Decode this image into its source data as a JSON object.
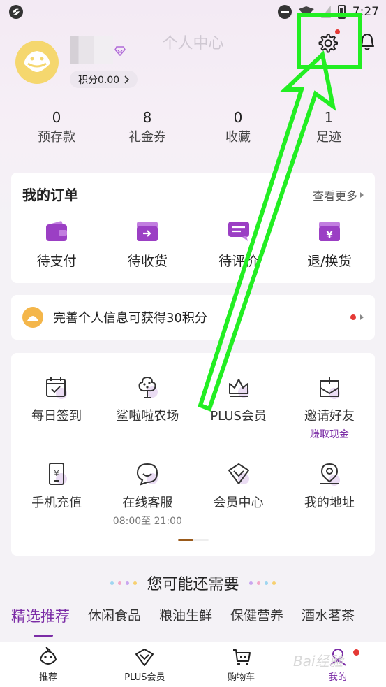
{
  "status_bar": {
    "time": "7:27"
  },
  "header": {
    "title": "个人中心",
    "points_label": "积分0.00"
  },
  "stats": [
    {
      "value": "0",
      "label": "预存款"
    },
    {
      "value": "8",
      "label": "礼金券"
    },
    {
      "value": "0",
      "label": "收藏"
    },
    {
      "value": "1",
      "label": "足迹"
    }
  ],
  "orders": {
    "title": "我的订单",
    "more": "查看更多",
    "items": [
      {
        "label": "待支付",
        "icon": "wallet-icon",
        "color": "#9b3fc4"
      },
      {
        "label": "待收货",
        "icon": "box-arrow-icon",
        "color": "#9b3fc4"
      },
      {
        "label": "待评价",
        "icon": "comment-icon",
        "color": "#9b3fc4"
      },
      {
        "label": "退/换货",
        "icon": "yen-box-icon",
        "color": "#9b3fc4"
      }
    ]
  },
  "info_banner": {
    "text": "完善个人信息可获得30积分"
  },
  "services": {
    "row1": [
      {
        "label": "每日签到",
        "sub": "",
        "icon": "calendar-check-icon"
      },
      {
        "label": "鲨啦啦农场",
        "sub": "",
        "icon": "tree-icon"
      },
      {
        "label": "PLUS会员",
        "sub": "",
        "icon": "crown-icon"
      },
      {
        "label": "邀请好友",
        "sub": "赚取现金",
        "icon": "invite-envelope-icon"
      }
    ],
    "row2": [
      {
        "label": "手机充值",
        "sub": "",
        "icon": "phone-yen-icon"
      },
      {
        "label": "在线客服",
        "sub": "08:00至 21:00",
        "icon": "chat-bubble-icon"
      },
      {
        "label": "会员中心",
        "sub": "",
        "icon": "diamond-icon"
      },
      {
        "label": "我的地址",
        "sub": "",
        "icon": "location-pin-icon"
      }
    ]
  },
  "recommend": {
    "title": "您可能还需要",
    "tabs": [
      "精选推荐",
      "休闲食品",
      "粮油生鲜",
      "保健营养",
      "酒水茗茶"
    ]
  },
  "bottom_nav": [
    {
      "label": "推荐",
      "icon": "shark-icon"
    },
    {
      "label": "PLUS会员",
      "icon": "diamond-icon"
    },
    {
      "label": "购物车",
      "icon": "cart-icon"
    },
    {
      "label": "我的",
      "icon": "profile-icon"
    }
  ],
  "watermark": "Bai经验",
  "colors": {
    "accent": "#7b2ca6",
    "annotation": "#22ee22",
    "badge": "#e53935"
  }
}
